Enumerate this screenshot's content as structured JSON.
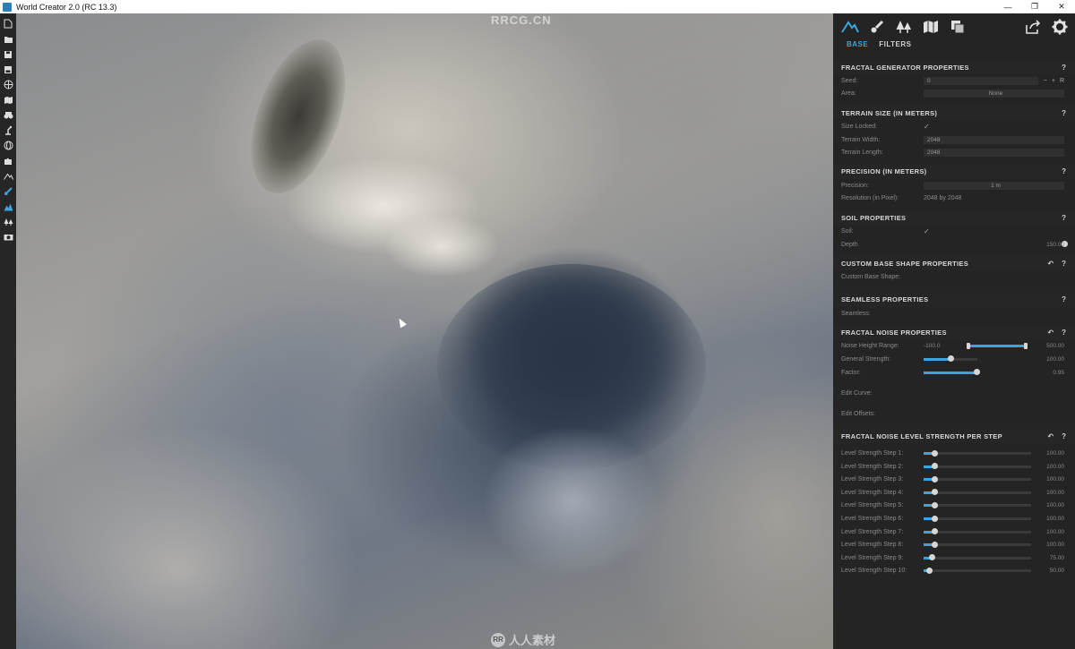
{
  "window": {
    "title": "World Creator 2.0 (RC 13.3)",
    "controls": [
      "—",
      "❐",
      "✕"
    ]
  },
  "left_toolbar": {
    "icons": [
      "new-file-icon",
      "open-folder-icon",
      "save-icon",
      "save-as-icon",
      "globe-grid-icon",
      "map-icon",
      "binoculars-icon",
      "robot-arm-icon",
      "sphere-icon",
      "puzzle-icon",
      "mountain-icon",
      "brush-icon",
      "terrain-icon",
      "trees-icon",
      "camera-icon"
    ]
  },
  "viewport": {
    "watermark_top": "RRCG.CN",
    "watermark_bottom": "人人素材"
  },
  "panel": {
    "toolbar_icons": [
      "mountain-icon",
      "brush-icon",
      "trees-icon",
      "map-icon",
      "layers-icon"
    ],
    "toolbar_right_icons": [
      "export-icon",
      "gear-icon"
    ],
    "tabs": [
      {
        "label": "BASE",
        "active": true
      },
      {
        "label": "FILTERS",
        "active": false
      }
    ],
    "fractal_generator": {
      "title": "FRACTAL GENERATOR PROPERTIES",
      "help": "?",
      "seed_label": "Seed:",
      "seed_value": "0",
      "seed_minus": "−",
      "seed_plus": "+",
      "seed_random": "R",
      "area_label": "Area:",
      "area_value": "None"
    },
    "terrain_size": {
      "title": "TERRAIN SIZE (IN METERS)",
      "help": "?",
      "size_locked_label": "Size Locked:",
      "size_locked_value": "✓",
      "width_label": "Terrain Width:",
      "width_value": "2048",
      "length_label": "Terrain Length:",
      "length_value": "2048"
    },
    "precision": {
      "title": "PRECISION (IN METERS)",
      "help": "?",
      "precision_label": "Precision:",
      "precision_value": "1 m",
      "resolution_label": "Resolution (in Pixel):",
      "resolution_value": "2048 by 2048"
    },
    "soil": {
      "title": "SOIL PROPERTIES",
      "help": "?",
      "soil_label": "Soil:",
      "soil_value": "✓",
      "depth_label": "Depth",
      "depth_value": "150.00",
      "depth_fraction": 1.0
    },
    "custom_base": {
      "title": "CUSTOM BASE SHAPE PROPERTIES",
      "reset": "↶",
      "help": "?",
      "shape_label": "Custom Base Shape:"
    },
    "seamless": {
      "title": "SEAMLESS PROPERTIES",
      "help": "?",
      "seamless_label": "Seamless:"
    },
    "fractal_noise": {
      "title": "FRACTAL NOISE PROPERTIES",
      "reset": "↶",
      "help": "?",
      "height_range_label": "Noise Height Range:",
      "height_range_min": "-100.0",
      "height_range_max": "500.00",
      "strength_label": "General Strength:",
      "strength_value": "100.00",
      "strength_fraction": 0.5,
      "factor_label": "Factor:",
      "factor_value": "0.95",
      "factor_fraction": 0.95,
      "edit_curve_label": "Edit Curve:",
      "edit_offsets_label": "Edit Offsets:"
    },
    "level_strength": {
      "title": "FRACTAL NOISE LEVEL STRENGTH PER STEP",
      "reset": "↶",
      "help": "?",
      "steps": [
        {
          "label": "Level Strength Step 1:",
          "value": "100.00",
          "fraction": 0.1
        },
        {
          "label": "Level Strength Step 2:",
          "value": "100.00",
          "fraction": 0.1
        },
        {
          "label": "Level Strength Step 3:",
          "value": "100.00",
          "fraction": 0.1
        },
        {
          "label": "Level Strength Step 4:",
          "value": "100.00",
          "fraction": 0.1
        },
        {
          "label": "Level Strength Step 5:",
          "value": "100.00",
          "fraction": 0.1
        },
        {
          "label": "Level Strength Step 6:",
          "value": "100.00",
          "fraction": 0.1
        },
        {
          "label": "Level Strength Step 7:",
          "value": "100.00",
          "fraction": 0.1
        },
        {
          "label": "Level Strength Step 8:",
          "value": "100.00",
          "fraction": 0.1
        },
        {
          "label": "Level Strength Step 9:",
          "value": "75.00",
          "fraction": 0.075
        },
        {
          "label": "Level Strength Step 10:",
          "value": "50.00",
          "fraction": 0.05
        }
      ]
    }
  },
  "colors": {
    "accent": "#3ea4e0",
    "panel_bg": "#242424"
  }
}
